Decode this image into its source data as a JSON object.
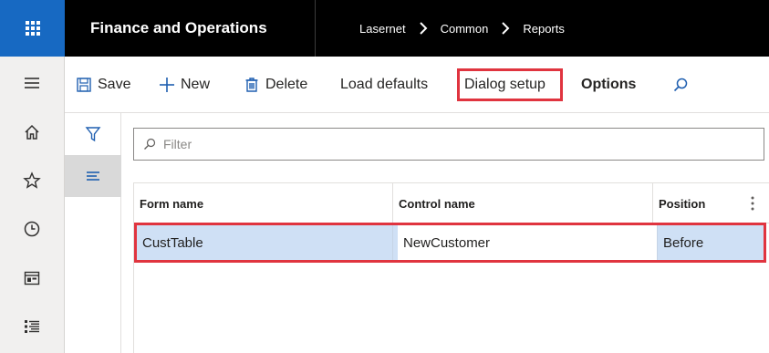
{
  "app": {
    "title": "Finance and Operations",
    "breadcrumb": [
      "Lasernet",
      "Common",
      "Reports"
    ]
  },
  "actions": {
    "save_label": "Save",
    "new_label": "New",
    "delete_label": "Delete",
    "load_defaults_label": "Load defaults",
    "dialog_setup_label": "Dialog setup",
    "options_label": "Options"
  },
  "filter": {
    "placeholder": "Filter"
  },
  "grid": {
    "columns": [
      "Form name",
      "Control name",
      "Position"
    ],
    "rows": [
      {
        "form_name": "CustTable",
        "control_name": "NewCustomer",
        "position": "Before"
      }
    ]
  },
  "icons": {
    "waffle": "app-launcher-icon",
    "hamburger": "menu-icon",
    "home": "home-icon",
    "favorites": "star-icon",
    "recent": "clock-icon",
    "workspaces": "workspace-icon",
    "modules": "modules-list-icon",
    "filter_pane": "funnel-icon",
    "list_view": "list-lines-icon"
  },
  "colors": {
    "accent": "#1769c2",
    "highlight": "#e0343f",
    "selected_row": "#cfe0f5"
  }
}
